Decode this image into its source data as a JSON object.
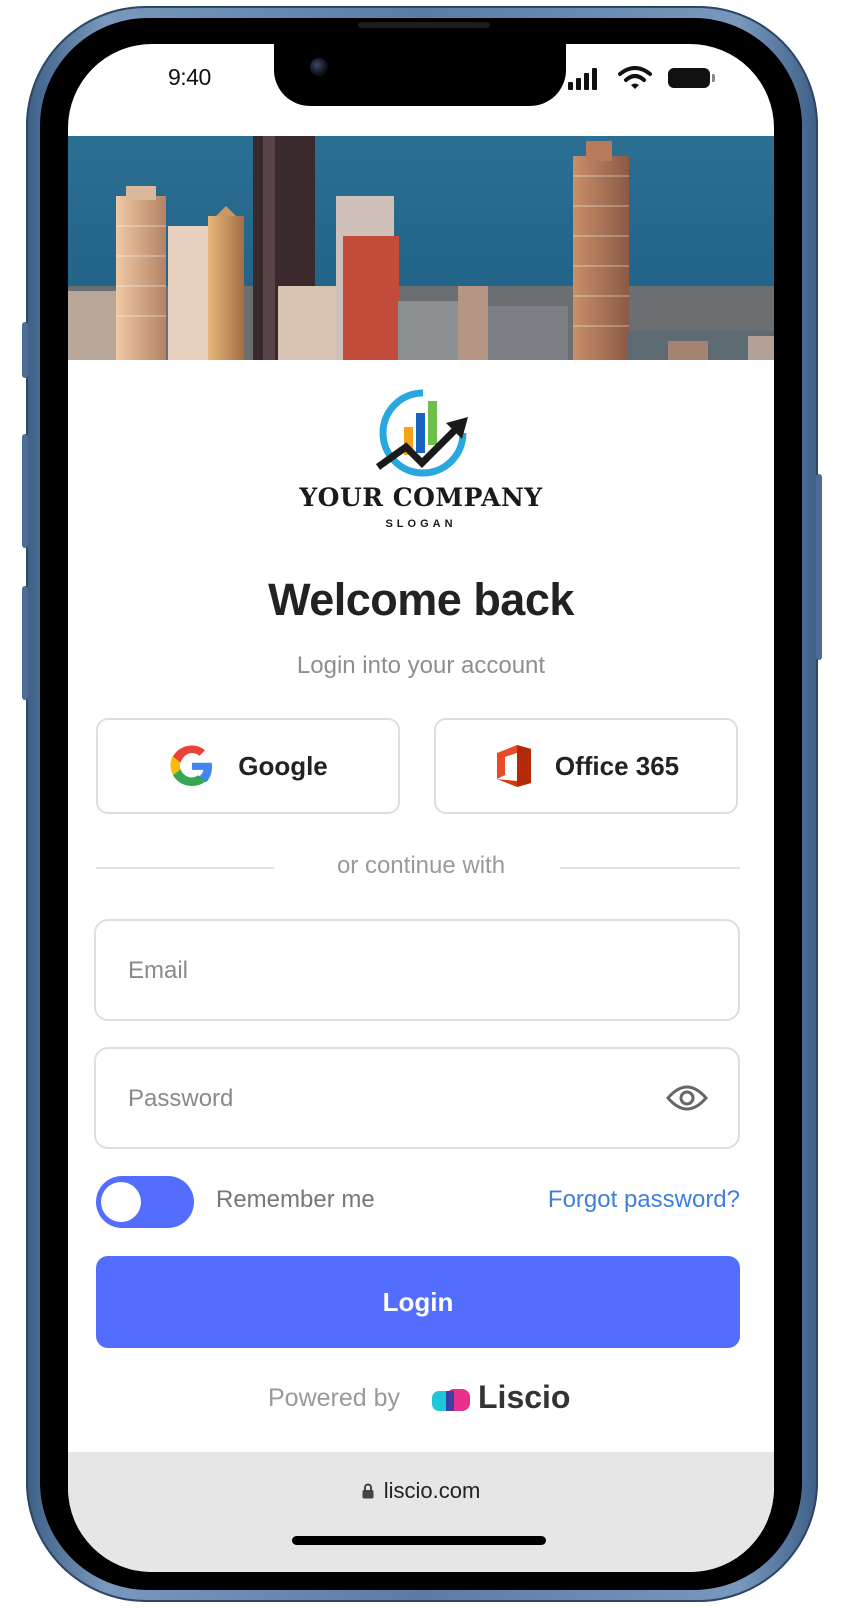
{
  "status_bar": {
    "time": "9:40"
  },
  "brand": {
    "company_name": "YOUR COMPANY",
    "slogan": "SLOGAN"
  },
  "login": {
    "title": "Welcome back",
    "subtitle": "Login into your account",
    "google_label": "Google",
    "office_label": "Office 365",
    "divider_text": "or continue with",
    "email_placeholder": "Email",
    "password_placeholder": "Password",
    "remember_label": "Remember me",
    "remember_enabled": true,
    "forgot_label": "Forgot password?",
    "login_label": "Login"
  },
  "footer": {
    "powered_by": "Powered by",
    "brand": "Liscio"
  },
  "browser": {
    "url": "liscio.com"
  },
  "colors": {
    "primary": "#536dfe",
    "link": "#3f7fe0",
    "frame": "#5a7ca4"
  },
  "icons": [
    "google-icon",
    "office-365-icon",
    "eye-icon",
    "lock-icon",
    "liscio-logo-icon",
    "company-logo-icon",
    "signal-icon",
    "wifi-icon",
    "battery-icon"
  ]
}
